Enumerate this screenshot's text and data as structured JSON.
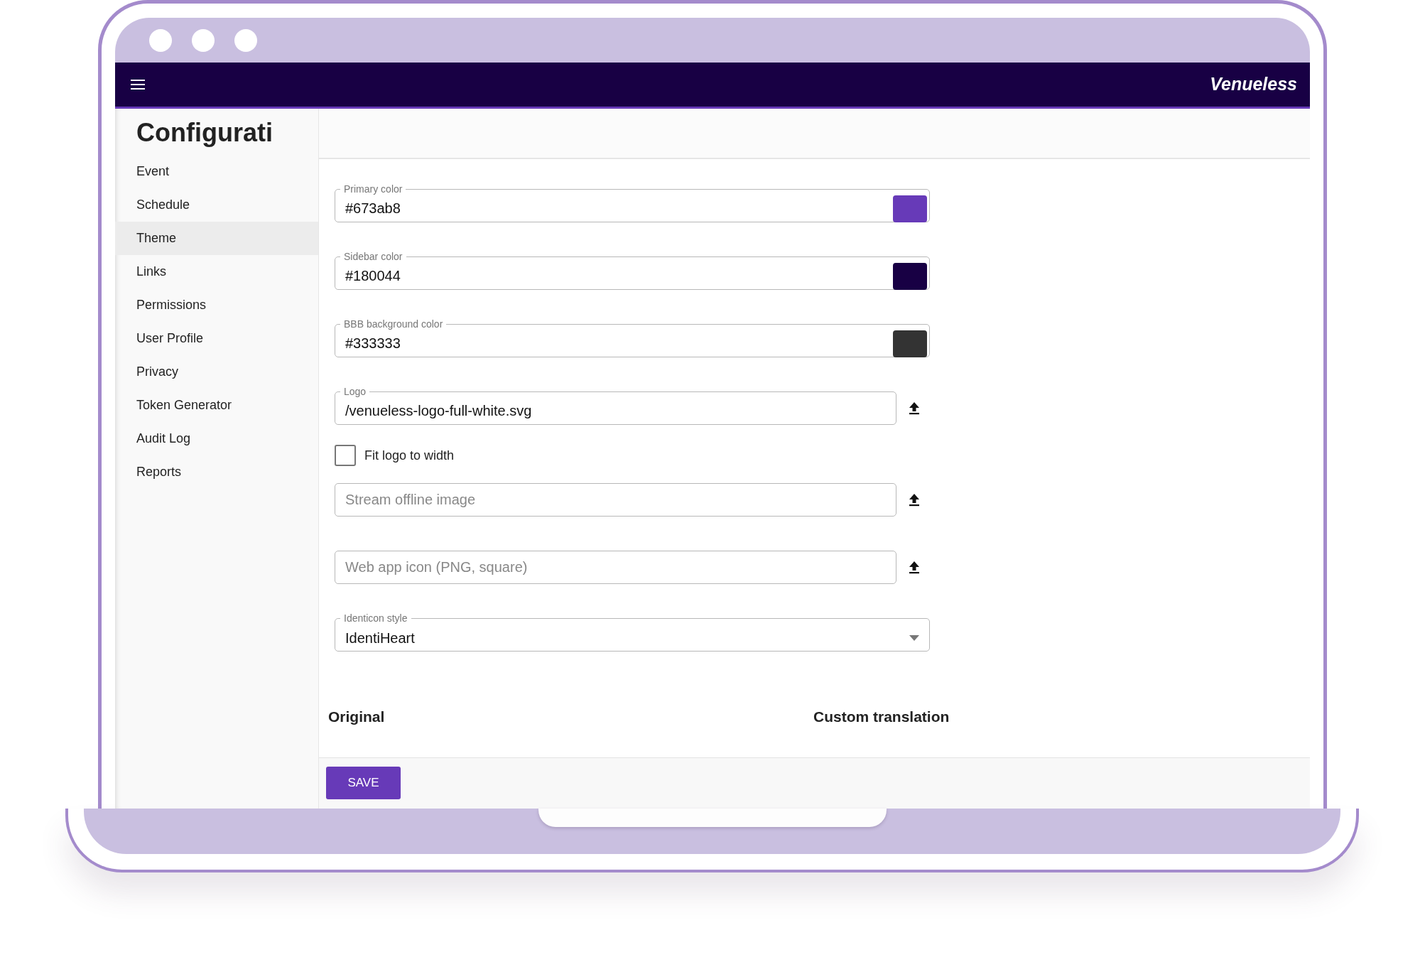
{
  "navbar": {
    "brand": "Venueless"
  },
  "sidebar": {
    "title": "Configurati",
    "items": [
      {
        "label": "Event",
        "selected": false
      },
      {
        "label": "Schedule",
        "selected": false
      },
      {
        "label": "Theme",
        "selected": true
      },
      {
        "label": "Links",
        "selected": false
      },
      {
        "label": "Permissions",
        "selected": false
      },
      {
        "label": "User Profile",
        "selected": false
      },
      {
        "label": "Privacy",
        "selected": false
      },
      {
        "label": "Token Generator",
        "selected": false
      },
      {
        "label": "Audit Log",
        "selected": false
      },
      {
        "label": "Reports",
        "selected": false
      }
    ]
  },
  "fields": [
    {
      "kind": "color",
      "label": "Primary color",
      "value": "#673ab8",
      "color": "#673ab8"
    },
    {
      "kind": "color",
      "label": "Sidebar color",
      "value": "#180044",
      "color": "#180044"
    },
    {
      "kind": "color",
      "label": "BBB background color",
      "value": "#333333",
      "color": "#333333"
    },
    {
      "kind": "upload",
      "label": "Logo",
      "value": "/venueless-logo-full-white.svg"
    },
    {
      "kind": "checkbox",
      "label": "Fit logo to width",
      "checked": false
    },
    {
      "kind": "upload",
      "placeholder": "Stream offline image"
    },
    {
      "kind": "upload",
      "placeholder": "Web app icon (PNG, square)"
    },
    {
      "kind": "select",
      "label": "Identicon style",
      "value": "IdentiHeart"
    }
  ],
  "translations": {
    "columns": [
      "Original",
      "Custom translation"
    ]
  },
  "footer": {
    "save_button": "SAVE"
  }
}
